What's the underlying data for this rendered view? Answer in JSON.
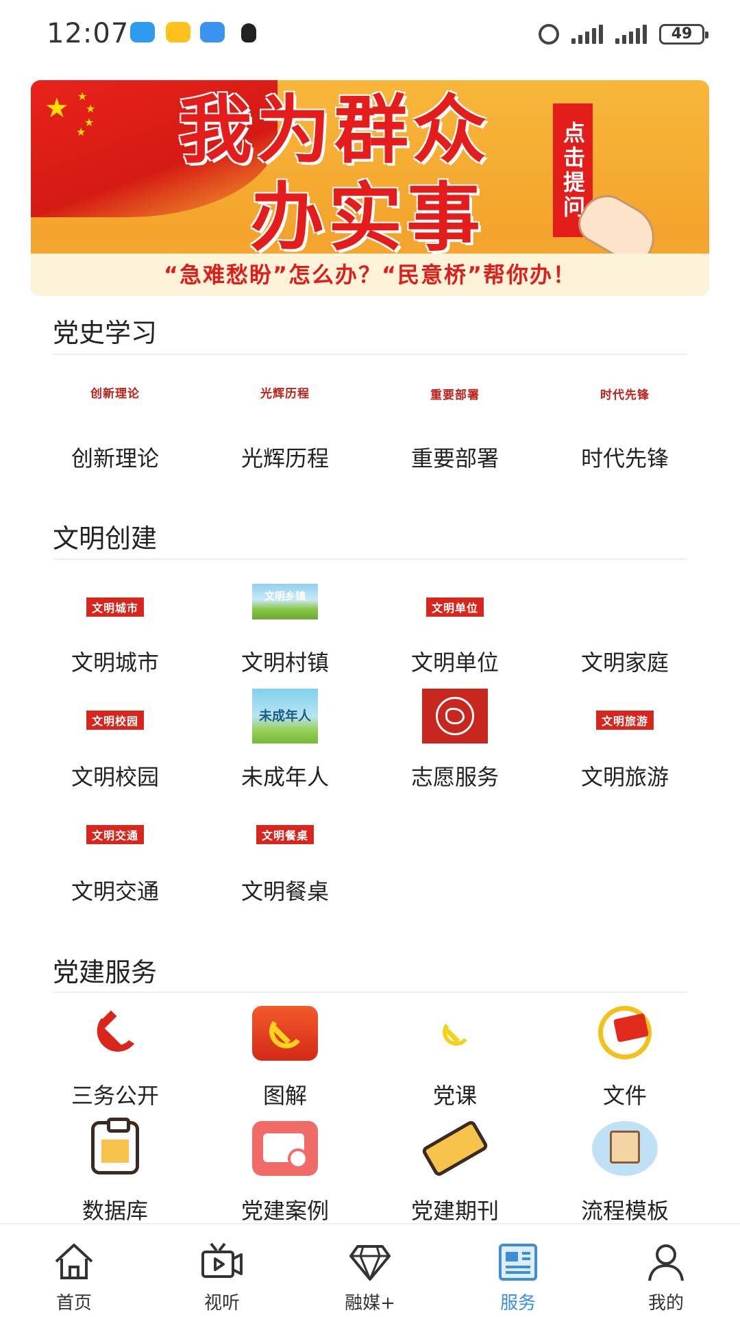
{
  "status_bar": {
    "time": "12:07",
    "battery": "49",
    "app_icons": [
      "cloud-app-icon",
      "chat-app-icon",
      "feather-app-icon",
      "qq-icon"
    ]
  },
  "banner": {
    "title_line1": "我为群众",
    "title_line2": "办实事",
    "click_label": "点击提问",
    "slogan": "“急难愁盼”怎么办？“民意桥”帮你办！"
  },
  "party_history": {
    "title": "党史学习",
    "items": [
      {
        "thumb_text": "创新理论",
        "label": "创新理论"
      },
      {
        "thumb_text": "光辉历程",
        "label": "光辉历程"
      },
      {
        "thumb_text": "重要部署",
        "label": "重要部署"
      },
      {
        "thumb_text": "时代先锋",
        "label": "时代先锋"
      }
    ]
  },
  "civilization": {
    "title": "文明创建",
    "items": [
      {
        "thumb_text": "文明城市",
        "label": "文明城市"
      },
      {
        "thumb_text": "文明乡镇",
        "label": "文明村镇"
      },
      {
        "thumb_text": "文明单位",
        "label": "文明单位"
      },
      {
        "thumb_text": "",
        "label": "文明家庭"
      },
      {
        "thumb_text": "文明校园",
        "label": "文明校园"
      },
      {
        "thumb_text": "未成年人",
        "label": "未成年人"
      },
      {
        "thumb_text": "",
        "label": "志愿服务"
      },
      {
        "thumb_text": "文明旅游",
        "label": "文明旅游"
      },
      {
        "thumb_text": "文明交通",
        "label": "文明交通"
      },
      {
        "thumb_text": "文明餐桌",
        "label": "文明餐桌"
      }
    ]
  },
  "party_service": {
    "title": "党建服务",
    "items": [
      {
        "label": "三务公开",
        "icon": "hammer-sickle-icon"
      },
      {
        "label": "图解",
        "icon": "party-emblem-icon"
      },
      {
        "label": "党课",
        "icon": "hammer-sickle-small-icon"
      },
      {
        "label": "文件",
        "icon": "party-flag-icon"
      },
      {
        "label": "数据库",
        "icon": "clipboard-icon"
      },
      {
        "label": "党建案例",
        "icon": "search-document-icon"
      },
      {
        "label": "党建期刊",
        "icon": "ticket-icon"
      },
      {
        "label": "流程模板",
        "icon": "box-icon"
      }
    ]
  },
  "bottom_nav": {
    "items": [
      {
        "label": "首页",
        "icon": "home-icon"
      },
      {
        "label": "视听",
        "icon": "tv-icon"
      },
      {
        "label": "融媒+",
        "icon": "diamond-icon"
      },
      {
        "label": "服务",
        "icon": "newspaper-icon"
      },
      {
        "label": "我的",
        "icon": "user-icon"
      }
    ],
    "active_index": 3,
    "active_color": "#3d8ed9"
  }
}
